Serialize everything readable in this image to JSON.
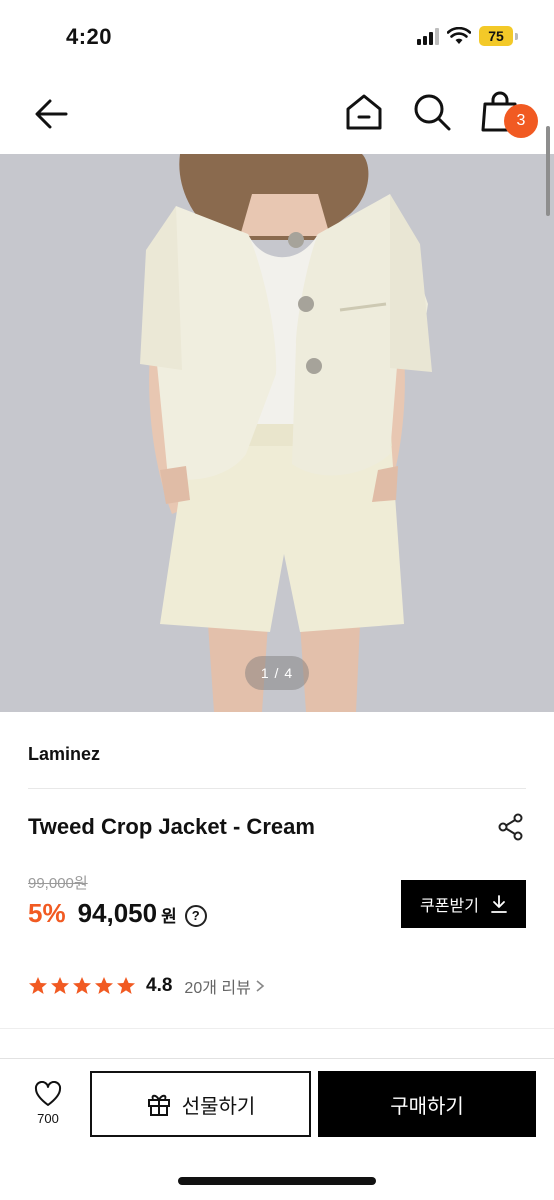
{
  "status_bar": {
    "time": "4:20",
    "battery": "75"
  },
  "nav": {
    "cart_count": "3"
  },
  "gallery": {
    "counter": "1 / 4"
  },
  "product": {
    "brand": "Laminez",
    "title": "Tweed Crop Jacket - Cream",
    "original_price": "99,000원",
    "discount": "5%",
    "sale_price": "94,050",
    "currency": "원",
    "help": "?",
    "rating": "4.8",
    "stars": 5,
    "review_link": "20개 리뷰"
  },
  "coupon_button": {
    "label": "쿠폰받기"
  },
  "bottom_bar": {
    "like_count": "700",
    "gift_label": "선물하기",
    "buy_label": "구매하기"
  },
  "colors": {
    "accent": "#f15a22",
    "star": "#f15a22",
    "battery": "#f3c928",
    "primary_button": "#000000"
  }
}
